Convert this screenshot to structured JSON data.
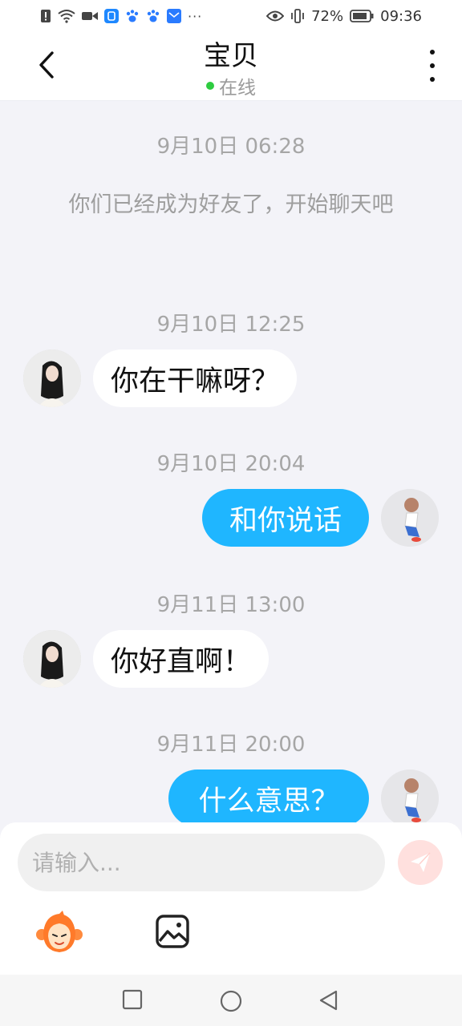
{
  "status_bar": {
    "icons": [
      "alert-icon",
      "wifi-icon",
      "video-icon",
      "app-icon",
      "paw-icon",
      "paw-icon",
      "mail-icon"
    ],
    "overflow": "···",
    "battery_percent": "72%",
    "time": "09:36"
  },
  "header": {
    "title": "宝贝",
    "status": "在线"
  },
  "messages": [
    {
      "type": "timestamp",
      "text": "9月10日 06:28"
    },
    {
      "type": "system",
      "text": "你们已经成为好友了，开始聊天吧"
    },
    {
      "type": "timestamp",
      "text": "9月10日 12:25"
    },
    {
      "type": "incoming",
      "text": "你在干嘛呀？"
    },
    {
      "type": "timestamp",
      "text": "9月10日 20:04"
    },
    {
      "type": "outgoing",
      "text": "和你说话"
    },
    {
      "type": "timestamp",
      "text": "9月11日 13:00"
    },
    {
      "type": "incoming",
      "text": "你好直啊！"
    },
    {
      "type": "timestamp",
      "text": "9月11日 20:00"
    },
    {
      "type": "outgoing",
      "text": "什么意思？"
    }
  ],
  "composer": {
    "placeholder": "请输入..."
  },
  "colors": {
    "accent_blue": "#1fb6ff",
    "online_green": "#2ecc40",
    "send_disabled": "#ffe0de"
  }
}
